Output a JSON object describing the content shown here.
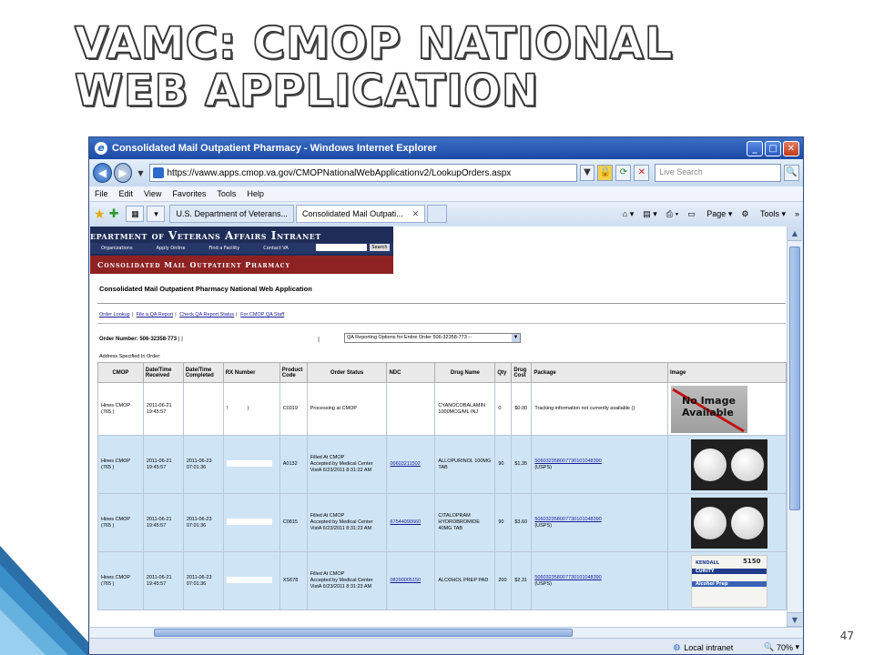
{
  "slide": {
    "title_line1": "VAMC: CMOP NATIONAL",
    "title_line2": "WEB APPLICATION",
    "page_number": "47"
  },
  "browser": {
    "window_title": "Consolidated Mail Outpatient Pharmacy - Windows Internet Explorer",
    "url": "https://vaww.apps.cmop.va.gov/CMOPNationalWebApplicationv2/LookupOrders.aspx",
    "search_placeholder": "Live Search",
    "menu": [
      "File",
      "Edit",
      "View",
      "Favorites",
      "Tools",
      "Help"
    ],
    "tabs": [
      {
        "label": "U.S. Department of Veterans...",
        "active": false
      },
      {
        "label": "Consolidated Mail Outpati...",
        "active": true
      }
    ],
    "toolbar": {
      "page": "Page",
      "tools": "Tools"
    },
    "status": {
      "zone": "Local intranet",
      "zoom": "70%"
    }
  },
  "page": {
    "va_name": "epartment of Veterans Affairs Intranet",
    "va_links": [
      "Organizations",
      "Apply Online",
      "Find a Facility",
      "Contact VA"
    ],
    "va_search_button": "Search",
    "cmop_bar": "Consolidated Mail Outpatient Pharmacy",
    "heading": "Consolidated Mail Outpatient Pharmacy National Web Application",
    "links": [
      "Order Lookup",
      "File a QA Report",
      "Check QA Report Status",
      "For CMOP QA Staff"
    ],
    "order_label": "Order Number: 506-32358-773",
    "qa_select": "QA Reporting Options for Entire Order 506-32358-773 --",
    "address_label": "Address Specified In Order:",
    "table": {
      "headers": [
        "CMOP",
        "Date/Time Received",
        "Date/Time Completed",
        "RX Number",
        "Product Code",
        "Order Status",
        "NDC",
        "Drug Name",
        "Qty",
        "Drug Cost",
        "Package",
        "Image"
      ],
      "rows": [
        {
          "cmop": "Hines CMOP (765 )",
          "received": "2011-06-21 19:45:57",
          "completed": "",
          "rx": "",
          "product": "C0319",
          "status": "Processing at CMOP",
          "ndc": "",
          "drug": "CYANOCOBALAMIN 1000MCG/ML INJ",
          "qty": "0",
          "cost": "$0.00",
          "package": "Tracking information not currently available ()",
          "image": "no-image",
          "image_text": "No Image Available"
        },
        {
          "cmop": "Hines CMOP (765 )",
          "received": "2011-06-21 19:45:57",
          "completed": "2011-06-23 07:01:36",
          "rx": "",
          "product": "A0132",
          "status": "Filled At CMOP\nAccepted by Medical Center VistA 6/23/2011 8:31:22 AM",
          "ndc": "00603211502",
          "drug": "ALLOPURINOL 100MG TAB",
          "qty": "90",
          "cost": "$1.35",
          "package": "506032358007730101048390",
          "carrier": "(USPS)",
          "image": "pills-allopurinol"
        },
        {
          "cmop": "Hines CMOP (765 )",
          "received": "2011-06-21 19:45:57",
          "completed": "2011-06-23 07:01:36",
          "rx": "",
          "product": "C0815",
          "status": "Filled At CMOP\nAccepted by Medical Center VistA 6/23/2011 8:31:23 AM",
          "ndc": "67544090660",
          "drug": "CITALOPRAM HYDROBROMIDE 40MG TAB",
          "qty": "90",
          "cost": "$3.60",
          "package": "506032358007730101048390",
          "carrier": "(USPS)",
          "image": "pills-citalopram"
        },
        {
          "cmop": "Hines CMOP (765 )",
          "received": "2011-06-21 19:45:57",
          "completed": "2011-06-23 07:01:36",
          "rx": "",
          "product": "XS678",
          "status": "Filled At CMOP\nAccepted by Medical Center VistA 6/23/2011 8:31:23 AM",
          "ndc": "08290005150",
          "drug": "ALCOHOL PREP PAD",
          "qty": "200",
          "cost": "$2.31",
          "package": "506032358007730101048390",
          "carrier": "(USPS)",
          "image": "alcohol-prep-label",
          "image_label_lines": [
            "KENDALL",
            "CURITY",
            "Alcohol Prep",
            "5150"
          ]
        }
      ]
    }
  },
  "colors": {
    "titlebar": "#1b4aa5",
    "va_banner": "#1e2c57",
    "cmop_bar": "#8e2222",
    "row_alt": "#cfe5f6",
    "link": "#1a1a9a"
  }
}
